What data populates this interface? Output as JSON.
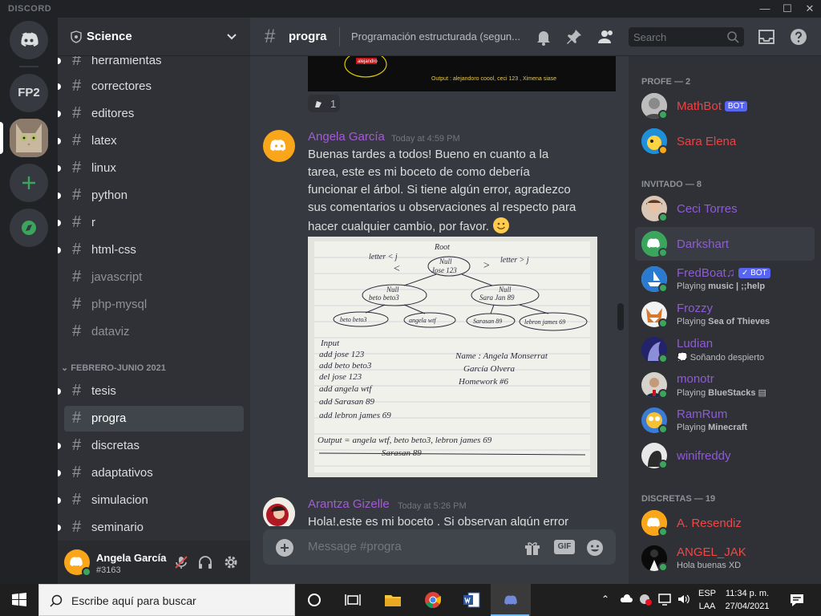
{
  "window": {
    "brand": "DISCORD",
    "controls": [
      "—",
      "☐",
      "✕"
    ]
  },
  "servers": {
    "home": "Discord",
    "fp2": "FP2"
  },
  "guild": {
    "name": "Science"
  },
  "channels": [
    {
      "name": "herramientas",
      "muted": false,
      "unread": true
    },
    {
      "name": "correctores",
      "muted": false,
      "unread": true
    },
    {
      "name": "editores",
      "muted": false,
      "unread": true
    },
    {
      "name": "latex",
      "muted": false,
      "unread": true
    },
    {
      "name": "linux",
      "muted": false,
      "unread": true
    },
    {
      "name": "python",
      "muted": false,
      "unread": true
    },
    {
      "name": "r",
      "muted": false,
      "unread": true
    },
    {
      "name": "html-css",
      "muted": false,
      "unread": true
    },
    {
      "name": "javascript",
      "muted": true,
      "unread": false
    },
    {
      "name": "php-mysql",
      "muted": true,
      "unread": false
    },
    {
      "name": "dataviz",
      "muted": true,
      "unread": false
    }
  ],
  "category": "FEBRERO-JUNIO 2021",
  "channels2": [
    {
      "name": "tesis",
      "active": false
    },
    {
      "name": "progra",
      "active": true
    },
    {
      "name": "discretas",
      "active": false
    },
    {
      "name": "adaptativos",
      "active": false
    },
    {
      "name": "simulacion",
      "active": false
    },
    {
      "name": "seminario",
      "active": false
    }
  ],
  "user": {
    "name": "Angela García",
    "tag": "#3163"
  },
  "header": {
    "channel": "progra",
    "topic": "Programación estructurada (segun..."
  },
  "search": {
    "placeholder": "Search"
  },
  "prev": {
    "output": "Output :  alejandoro coool, ceci 123 , Ximena siase",
    "bubble": "alejandro",
    "reaction_count": "1"
  },
  "messages": [
    {
      "author": "Angela García",
      "time": "Today at 4:59 PM",
      "text": "Buenas tardes a todos! Bueno en cuanto a la tarea, este es mi boceto de como debería funcionar el árbol. Si tiene algún error, agradezco sus comentarios u observaciones al respecto para hacer cualquier cambio, por favor."
    },
    {
      "author": "Arantza Gizelle",
      "time": "Today at 5:26 PM",
      "text": "Hola!,este es mi boceto . Si observan algún error"
    }
  ],
  "photo": {
    "root": "Root",
    "left_lbl": "letter < j",
    "right_lbl": "letter > j",
    "n1": "Null",
    "n1b": "Jose 123",
    "n2": "Null",
    "n2b": "beto beto3",
    "n3": "Null",
    "n3b": "Sara Jan 89",
    "leaves": [
      "angela wtf",
      "beto beto3",
      "Sarasan 89",
      "lebron james 69"
    ],
    "input_title": "Input",
    "inputs": [
      "add jose 123",
      "add beto beto3",
      "del jose 123",
      "add angela wtf",
      "add Sarasan 89",
      "add lebron james 69"
    ],
    "name_line": "Name : Angela Monserrat",
    "name_line2": "García Olvera",
    "hw": "Homework #6",
    "output1": "Output = angela wtf, beto beto3, lebron james 69",
    "output2": "Sarasan 89"
  },
  "composer": {
    "placeholder": "Message #progra",
    "gif": "GIF"
  },
  "members": {
    "groups": [
      {
        "label": "PROFE — 2"
      },
      {
        "label": "INVITADO — 8"
      },
      {
        "label": "DISCRETAS — 19"
      }
    ],
    "profe": [
      {
        "name": "MathBot",
        "bot": "BOT",
        "status": ""
      },
      {
        "name": "Sara Elena",
        "status": ""
      }
    ],
    "invitado": [
      {
        "name": "Ceci Torres",
        "status": ""
      },
      {
        "name": "Darkshart",
        "status": ""
      },
      {
        "name": "FredBoat♫",
        "bot": "✓ BOT",
        "status_prefix": "Playing ",
        "status_bold": "music | ;;help"
      },
      {
        "name": "Frozzy",
        "status_prefix": "Playing ",
        "status_bold": "Sea of Thieves"
      },
      {
        "name": "Ludian",
        "status_prefix": "",
        "status_bold": "",
        "status": "Soñando despierto"
      },
      {
        "name": "monotr",
        "status_prefix": "Playing ",
        "status_bold": "BlueStacks"
      },
      {
        "name": "RamRum",
        "status_prefix": "Playing ",
        "status_bold": "Minecraft"
      },
      {
        "name": "winifreddy",
        "status": ""
      }
    ],
    "discretas": [
      {
        "name": "A. Resendiz",
        "status": ""
      },
      {
        "name": "ANGEL_JAK",
        "status": "Hola buenas XD"
      }
    ]
  },
  "taskbar": {
    "search_placeholder": "Escribe aquí para buscar",
    "lang1": "ESP",
    "lang2": "LAA",
    "time": "11:34 p. m.",
    "date": "27/04/2021"
  },
  "colors": {
    "accent": "#5865f2",
    "online": "#3ba55d",
    "author": "#a35bd4"
  }
}
